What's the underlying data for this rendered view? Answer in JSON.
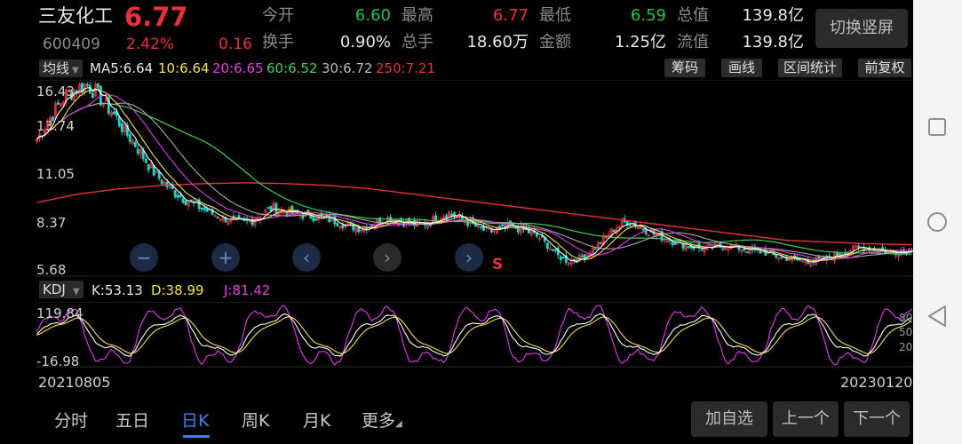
{
  "stock": {
    "name": "三友化工",
    "price": "6.77",
    "code": "600409",
    "change_pct": "2.42%",
    "change": "0.16"
  },
  "quote": {
    "open_label": "今开",
    "open": "6.60",
    "high_label": "最高",
    "high": "6.77",
    "low_label": "最低",
    "low": "6.59",
    "total_cap_label": "总值",
    "total_cap": "139.8亿",
    "turnover_label": "换手",
    "turnover": "0.90%",
    "volume_label": "总手",
    "volume": "18.60万",
    "amount_label": "金额",
    "amount": "1.25亿",
    "float_cap_label": "流值",
    "float_cap": "139.8亿"
  },
  "toolbar": {
    "switch_label": "切换竖屏",
    "ma_selector": "均线",
    "ma5": "MA5:6.64",
    "ma10": "10:6.64",
    "ma20": "20:6.65",
    "ma60": "60:6.52",
    "ma30": "30:6.72",
    "ma250": "250:7.21",
    "chip_label": "筹码",
    "draw_label": "画线",
    "range_label": "区间统计",
    "adjust_label": "前复权"
  },
  "price_axis": [
    "16.43",
    "13.74",
    "11.05",
    "8.37",
    "5.68"
  ],
  "kdj": {
    "selector": "KDJ",
    "k": "K:53.13",
    "d": "D:38.99",
    "j": "J:81.42",
    "axis_top": "119.84",
    "axis_bottom": "-16.98",
    "right_80": "80",
    "right_50": "50",
    "right_20": "20"
  },
  "dates": {
    "start": "20210805",
    "end": "20230120"
  },
  "marker": "S",
  "chart_data": {
    "type": "line",
    "price_series_approx": [
      13.2,
      14.1,
      15.0,
      15.8,
      16.1,
      16.4,
      15.9,
      15.2,
      14.5,
      13.6,
      12.9,
      12.0,
      11.2,
      10.6,
      10.1,
      9.7,
      9.4,
      9.1,
      8.8,
      8.6,
      8.4,
      8.3,
      8.5,
      8.9,
      9.2,
      9.0,
      8.9,
      8.8,
      8.7,
      8.6,
      8.5,
      8.3,
      8.1,
      8.0,
      8.2,
      8.5,
      8.6,
      8.4,
      8.3,
      8.2,
      8.4,
      8.7,
      8.9,
      8.6,
      8.3,
      8.0,
      7.8,
      7.9,
      8.1,
      8.0,
      7.8,
      7.5,
      7.0,
      6.4,
      6.1,
      6.2,
      6.5,
      7.0,
      7.6,
      8.1,
      8.4,
      8.2,
      7.9,
      7.6,
      7.4,
      7.2,
      7.0,
      6.9,
      6.8,
      6.9,
      7.0,
      6.9,
      6.8,
      6.7,
      6.6,
      6.4,
      6.3,
      6.2,
      6.1,
      6.1,
      6.2,
      6.4,
      6.6,
      6.8,
      6.9,
      6.8,
      6.7,
      6.6,
      6.7,
      6.8
    ],
    "ma250_approx": [
      9.5,
      10.0,
      10.3,
      10.5,
      10.6,
      10.65,
      10.6,
      10.5,
      10.3,
      10.0,
      9.7,
      9.4,
      9.1,
      8.8,
      8.5,
      8.2,
      7.9,
      7.6,
      7.3,
      7.2,
      7.1,
      7.05
    ],
    "ylim": [
      5.68,
      16.43
    ],
    "kdj_ylim": [
      -16.98,
      119.84
    ]
  }
}
